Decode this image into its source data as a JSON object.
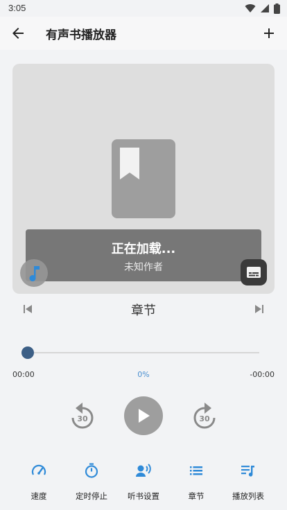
{
  "status_bar": {
    "time": "3:05"
  },
  "app_bar": {
    "title": "有声书播放器"
  },
  "cover": {
    "loading_text": "正在加载...",
    "author": "未知作者"
  },
  "chapter": {
    "label": "章节"
  },
  "progress": {
    "fraction": 0.0,
    "elapsed": "00:00",
    "percent": "0%",
    "remaining": "-00:00"
  },
  "controls": {
    "rewind_seconds": "30",
    "forward_seconds": "30"
  },
  "bottom_nav": [
    {
      "label": "速度",
      "icon": "speed-icon"
    },
    {
      "label": "定时停止",
      "icon": "timer-icon"
    },
    {
      "label": "听书设置",
      "icon": "voice-settings-icon"
    },
    {
      "label": "章节",
      "icon": "list-icon"
    },
    {
      "label": "播放列表",
      "icon": "playlist-icon"
    }
  ],
  "colors": {
    "accent": "#2f8ad8",
    "thumb": "#3d5f86",
    "percent": "#4a8fd0"
  }
}
